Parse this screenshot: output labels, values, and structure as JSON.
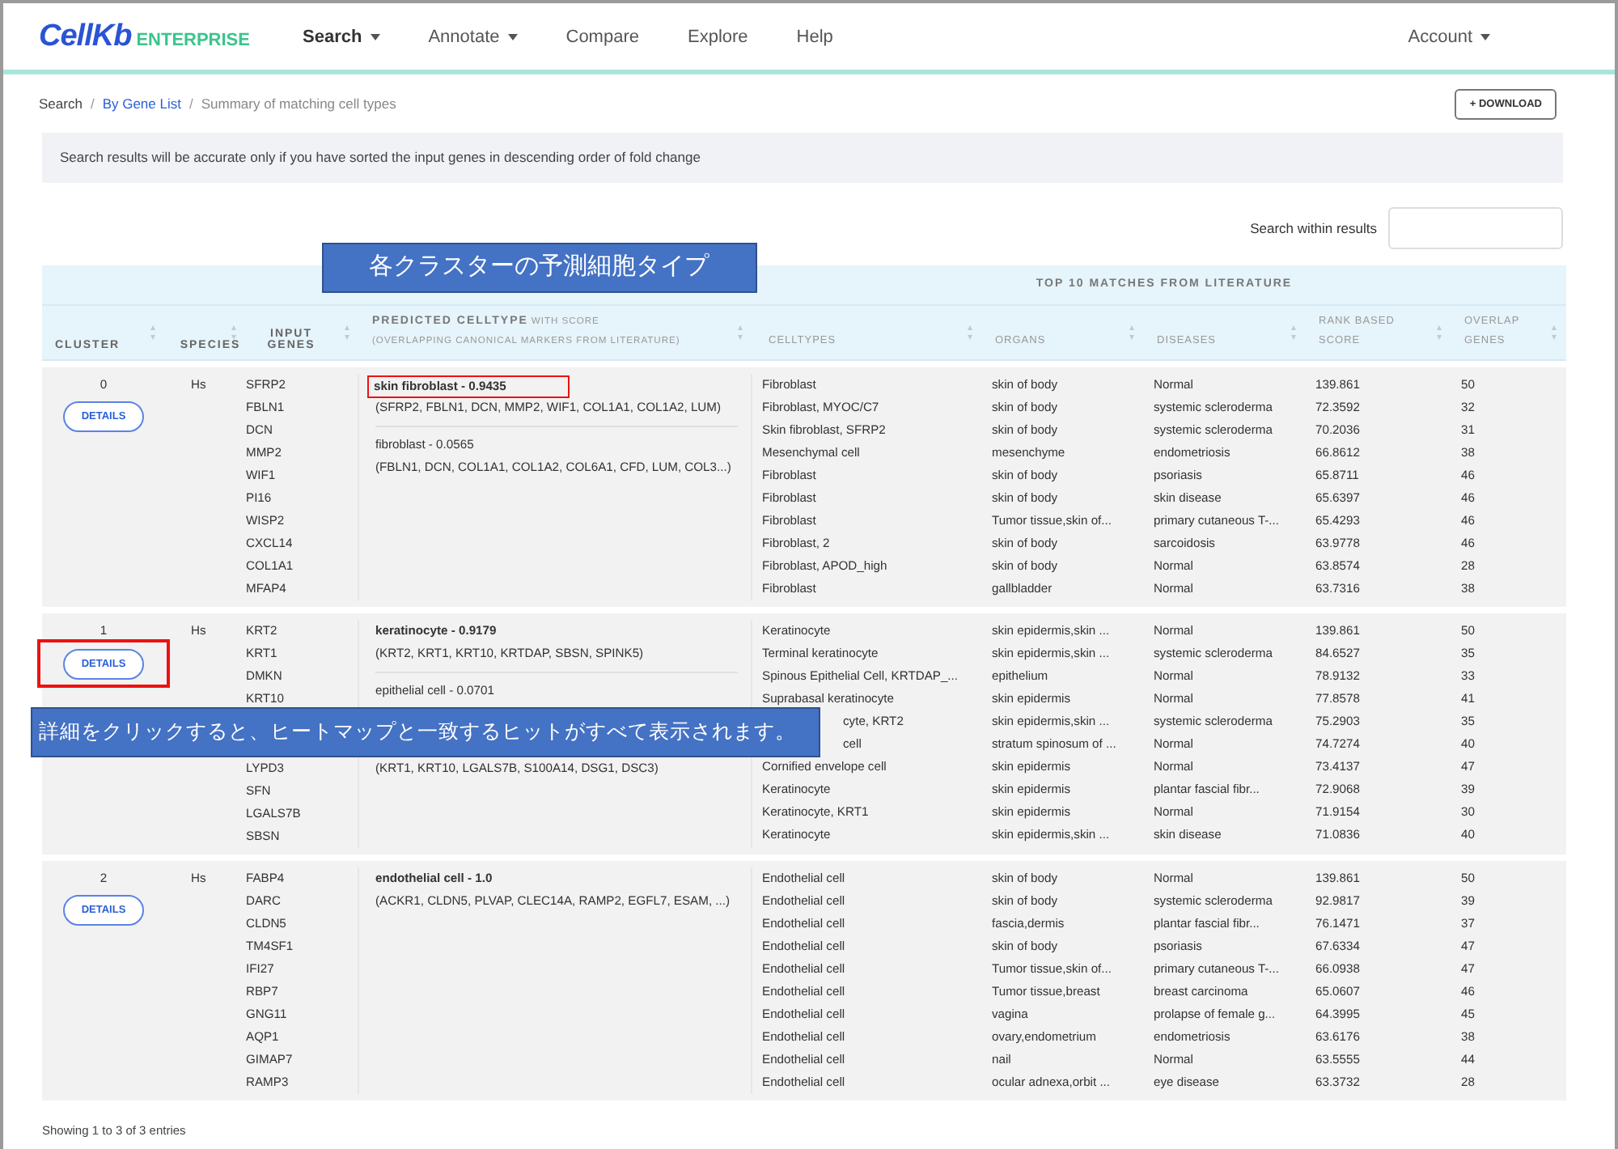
{
  "brand": {
    "name": "CellKb",
    "edition": "ENTERPRISE"
  },
  "nav": [
    {
      "label": "Search",
      "dropdown": true,
      "selected": true
    },
    {
      "label": "Annotate",
      "dropdown": true,
      "selected": false
    },
    {
      "label": "Compare",
      "dropdown": false,
      "selected": false
    },
    {
      "label": "Explore",
      "dropdown": false,
      "selected": false
    },
    {
      "label": "Help",
      "dropdown": false,
      "selected": false
    }
  ],
  "account": {
    "label": "Account",
    "dropdown": true
  },
  "breadcrumb_separator": "/",
  "breadcrumb": [
    {
      "label": "Search",
      "kind": "plain"
    },
    {
      "label": "By Gene List",
      "kind": "link"
    },
    {
      "label": "Summary of matching cell types",
      "kind": "current"
    }
  ],
  "download_button": "+ DOWNLOAD",
  "notice": "Search results will be accurate only if you have sorted the input genes in descending order of fold change",
  "search": {
    "label": "Search within results"
  },
  "table": {
    "group_header": "TOP 10 MATCHES FROM LITERATURE",
    "header_callout": "各クラスターの予測細胞タイプ",
    "columns": [
      {
        "label": "CLUSTER",
        "kind": "bold"
      },
      {
        "label": "SPECIES",
        "kind": "bold"
      },
      {
        "label": "INPUT GENES",
        "kind": "bold"
      },
      {
        "label": "PREDICTED CELLTYPE",
        "sub": "WITH SCORE",
        "note": "(OVERLAPPING CANONICAL MARKERS FROM LITERATURE)",
        "kind": "predicted"
      },
      {
        "label": "CELLTYPES",
        "kind": "light"
      },
      {
        "label": "ORGANS",
        "kind": "light"
      },
      {
        "label": "DISEASES",
        "kind": "light"
      },
      {
        "label": "RANK BASED SCORE",
        "kind": "light"
      },
      {
        "label": "OVERLAP GENES",
        "kind": "light"
      }
    ],
    "clusters": [
      {
        "id": "0",
        "species": "Hs",
        "details": {
          "label": "DETAILS",
          "highlighted": false
        },
        "genes": [
          "SFRP2",
          "FBLN1",
          "DCN",
          "MMP2",
          "WIF1",
          "PI16",
          "WISP2",
          "CXCL14",
          "COL1A1",
          "MFAP4"
        ],
        "predicted": [
          {
            "name": "skin fibroblast - 0.9435",
            "markers": "(SFRP2, FBLN1, DCN, MMP2, WIF1, COL1A1, COL1A2, LUM)",
            "top": true,
            "highlighted": true
          },
          {
            "name": "fibroblast - 0.0565",
            "markers": "(FBLN1, DCN, COL1A1, COL1A2, COL6A1, CFD, LUM, COL3...)",
            "top": false,
            "highlighted": false
          }
        ],
        "matches": [
          {
            "celltype": "Fibroblast",
            "organ": "skin of body",
            "disease": "Normal",
            "score": "139.861",
            "overlap": "50"
          },
          {
            "celltype": "Fibroblast, MYOC/C7",
            "organ": "skin of body",
            "disease": "systemic scleroderma",
            "score": "72.3592",
            "overlap": "32"
          },
          {
            "celltype": "Skin fibroblast, SFRP2",
            "organ": "skin of body",
            "disease": "systemic scleroderma",
            "score": "70.2036",
            "overlap": "31"
          },
          {
            "celltype": "Mesenchymal cell",
            "organ": "mesenchyme",
            "disease": "endometriosis",
            "score": "66.8612",
            "overlap": "38"
          },
          {
            "celltype": "Fibroblast",
            "organ": "skin of body",
            "disease": "psoriasis",
            "score": "65.8711",
            "overlap": "46"
          },
          {
            "celltype": "Fibroblast",
            "organ": "skin of body",
            "disease": "skin disease",
            "score": "65.6397",
            "overlap": "46"
          },
          {
            "celltype": "Fibroblast",
            "organ": "Tumor tissue,skin of...",
            "disease": "primary cutaneous T-...",
            "score": "65.4293",
            "overlap": "46"
          },
          {
            "celltype": "Fibroblast, 2",
            "organ": "skin of body",
            "disease": "sarcoidosis",
            "score": "63.9778",
            "overlap": "46"
          },
          {
            "celltype": "Fibroblast, APOD_high",
            "organ": "skin of body",
            "disease": "Normal",
            "score": "63.8574",
            "overlap": "28"
          },
          {
            "celltype": "Fibroblast",
            "organ": "gallbladder",
            "disease": "Normal",
            "score": "63.7316",
            "overlap": "38"
          }
        ]
      },
      {
        "id": "1",
        "species": "Hs",
        "details": {
          "label": "DETAILS",
          "highlighted": true
        },
        "genes": [
          "KRT2",
          "KRT1",
          "DMKN",
          "KRT10"
        ],
        "callout": "詳細をクリックすると、ヒートマップと一致するヒットがすべて表示されます。",
        "genes_after_callout": [
          "LYPD3",
          "SFN",
          "LGALS7B",
          "SBSN"
        ],
        "predicted": [
          {
            "name": "keratinocyte - 0.9179",
            "markers": "(KRT2, KRT1, KRT10, KRTDAP, SBSN, SPINK5)",
            "top": true,
            "highlighted": false
          },
          {
            "name": "epithelial cell - 0.0701",
            "markers": "(KRT1, KRT10, LGALS7B, S100A14, DSG1, DSC3)",
            "top": false,
            "highlighted": false
          }
        ],
        "matches": [
          {
            "celltype": "Keratinocyte",
            "organ": "skin epidermis,skin ...",
            "disease": "Normal",
            "score": "139.861",
            "overlap": "50"
          },
          {
            "celltype": "Terminal keratinocyte",
            "organ": "skin epidermis,skin ...",
            "disease": "systemic scleroderma",
            "score": "84.6527",
            "overlap": "35"
          },
          {
            "celltype": "Spinous Epithelial Cell, KRTDAP_...",
            "organ": "epithelium",
            "disease": "Normal",
            "score": "78.9132",
            "overlap": "33"
          },
          {
            "celltype": "Suprabasal keratinocyte",
            "organ": "skin epidermis",
            "disease": "Normal",
            "score": "77.8578",
            "overlap": "41"
          },
          {
            "celltype": "cyte, KRT2",
            "clipped": true,
            "organ": "skin epidermis,skin ...",
            "disease": "systemic scleroderma",
            "score": "75.2903",
            "overlap": "35"
          },
          {
            "celltype": "cell",
            "clipped": true,
            "organ": "stratum spinosum of ...",
            "disease": "Normal",
            "score": "74.7274",
            "overlap": "40"
          },
          {
            "celltype": "Cornified envelope cell",
            "organ": "skin epidermis",
            "disease": "Normal",
            "score": "73.4137",
            "overlap": "47"
          },
          {
            "celltype": "Keratinocyte",
            "organ": "skin epidermis",
            "disease": "plantar fascial fibr...",
            "score": "72.9068",
            "overlap": "39"
          },
          {
            "celltype": "Keratinocyte, KRT1",
            "organ": "skin epidermis",
            "disease": "Normal",
            "score": "71.9154",
            "overlap": "30"
          },
          {
            "celltype": "Keratinocyte",
            "organ": "skin epidermis,skin ...",
            "disease": "skin disease",
            "score": "71.0836",
            "overlap": "40"
          }
        ]
      },
      {
        "id": "2",
        "species": "Hs",
        "details": {
          "label": "DETAILS",
          "highlighted": false
        },
        "genes": [
          "FABP4",
          "DARC",
          "CLDN5",
          "TM4SF1",
          "IFI27",
          "RBP7",
          "GNG11",
          "AQP1",
          "GIMAP7",
          "RAMP3"
        ],
        "predicted": [
          {
            "name": "endothelial cell - 1.0",
            "markers": "(ACKR1, CLDN5, PLVAP, CLEC14A, RAMP2, EGFL7, ESAM, ...)",
            "top": true,
            "highlighted": false
          }
        ],
        "matches": [
          {
            "celltype": "Endothelial cell",
            "organ": "skin of body",
            "disease": "Normal",
            "score": "139.861",
            "overlap": "50"
          },
          {
            "celltype": "Endothelial cell",
            "organ": "skin of body",
            "disease": "systemic scleroderma",
            "score": "92.9817",
            "overlap": "39"
          },
          {
            "celltype": "Endothelial cell",
            "organ": "fascia,dermis",
            "disease": "plantar fascial fibr...",
            "score": "76.1471",
            "overlap": "37"
          },
          {
            "celltype": "Endothelial cell",
            "organ": "skin of body",
            "disease": "psoriasis",
            "score": "67.6334",
            "overlap": "47"
          },
          {
            "celltype": "Endothelial cell",
            "organ": "Tumor tissue,skin of...",
            "disease": "primary cutaneous T-...",
            "score": "66.0938",
            "overlap": "47"
          },
          {
            "celltype": "Endothelial cell",
            "organ": "Tumor tissue,breast",
            "disease": "breast carcinoma",
            "score": "65.0607",
            "overlap": "46"
          },
          {
            "celltype": "Endothelial cell",
            "organ": "vagina",
            "disease": "prolapse of female g...",
            "score": "64.3995",
            "overlap": "45"
          },
          {
            "celltype": "Endothelial cell",
            "organ": "ovary,endometrium",
            "disease": "endometriosis",
            "score": "63.6176",
            "overlap": "38"
          },
          {
            "celltype": "Endothelial cell",
            "organ": "nail",
            "disease": "Normal",
            "score": "63.5555",
            "overlap": "44"
          },
          {
            "celltype": "Endothelial cell",
            "organ": "ocular adnexa,orbit ...",
            "disease": "eye disease",
            "score": "63.3732",
            "overlap": "28"
          }
        ]
      }
    ]
  },
  "footer": "Showing 1 to 3 of 3 entries"
}
